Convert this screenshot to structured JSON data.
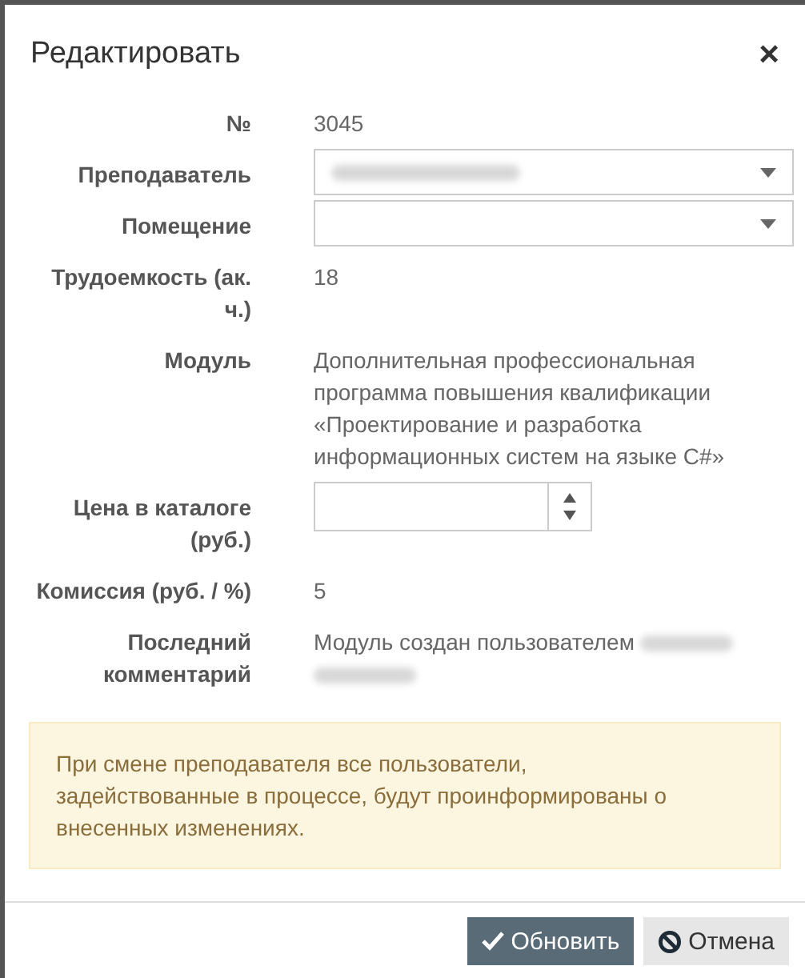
{
  "dialog": {
    "title": "Редактировать",
    "close": "×"
  },
  "fields": [
    {
      "kind": "text",
      "label": "№",
      "value": "3045"
    },
    {
      "kind": "select",
      "label": "Преподаватель",
      "redacted": true
    },
    {
      "kind": "select",
      "label": "Помещение",
      "redacted": false
    },
    {
      "kind": "text",
      "label": "Трудоемкость (ак. ч.)",
      "value": "18"
    },
    {
      "kind": "text",
      "label": "Модуль",
      "value": "Дополнительная профессиональная программа повышения квалификации «Проектирование и разработка информационных систем на языке C#»"
    },
    {
      "kind": "number",
      "label": "Цена в каталоге (руб.)"
    },
    {
      "kind": "text",
      "label": "Комиссия (руб. / %)",
      "value": "5"
    },
    {
      "kind": "text",
      "label": "Последний комментарий",
      "value": "Модуль создан пользователем",
      "redacted": true
    }
  ],
  "alert": "При смене преподавателя все пользователи, задействованные в процессе, будут проинформированы о внесенных изменениях.",
  "buttons": [
    {
      "kind": "primary",
      "label": "Обновить"
    },
    {
      "kind": "cancel",
      "label": "Отмена"
    }
  ]
}
